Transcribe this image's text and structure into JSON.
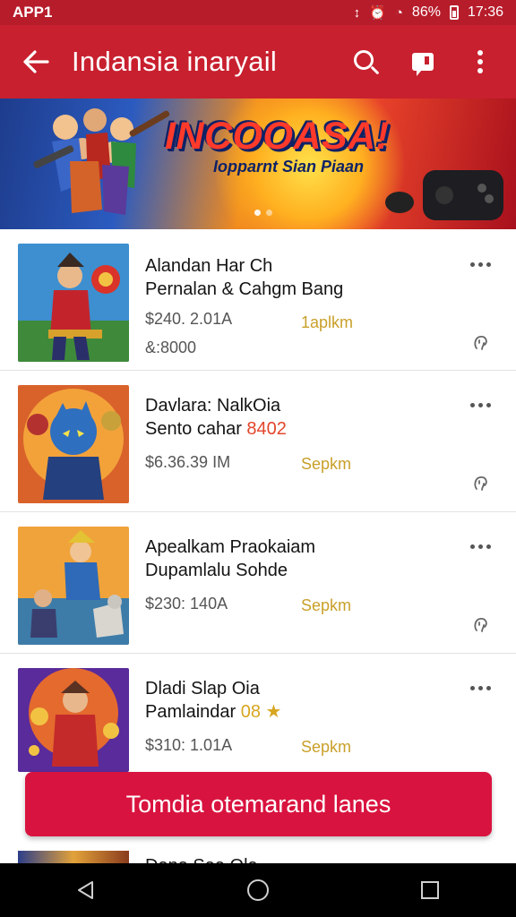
{
  "status_bar": {
    "app_label": "APP1",
    "signal": "86%",
    "time": "17:36"
  },
  "app_bar": {
    "title": "Indansia inaryail",
    "back_icon": "arrow-left-icon",
    "search_icon": "search-icon",
    "chat_icon": "chat-icon",
    "more_icon": "more-vert-icon"
  },
  "banner": {
    "title": "INCOOASA!",
    "subtitle": "Iopparnt Sian Piaan",
    "slides": 2,
    "active_slide": 1
  },
  "items": [
    {
      "title_line1": "Alandan Har Ch",
      "title_line2": "Pernalan & Cahgm Bang",
      "title_line2_accent": "",
      "price": "$240. 2.01A",
      "tag": "1aplkm",
      "meta": "&:8000"
    },
    {
      "title_line1": "Davlara: NalkOia",
      "title_line2": "Sento cahar ",
      "title_line2_accent": "8402",
      "price": "$6.36.39 IM",
      "tag": "Sepkm",
      "meta": ""
    },
    {
      "title_line1": "Apealkam Praokaiam",
      "title_line2": "Dupamlalu Sohde",
      "title_line2_accent": "",
      "price": "$230: 140A",
      "tag": "Sepkm",
      "meta": ""
    },
    {
      "title_line1": "Dladi Slap Oia",
      "title_line2": "Pamlaindar ",
      "title_line2_accent": "08",
      "price": "$310: 1.01A",
      "tag": "Sepkm",
      "meta": ""
    }
  ],
  "cta": {
    "label": "Tomdia otemarand lanes"
  },
  "partial_item": {
    "title": "Dana Saa Ola"
  },
  "colors": {
    "app_bar": "#c8202f",
    "status_bar": "#b71c2b",
    "cta": "#d9133f",
    "tag": "#c9a02a"
  }
}
